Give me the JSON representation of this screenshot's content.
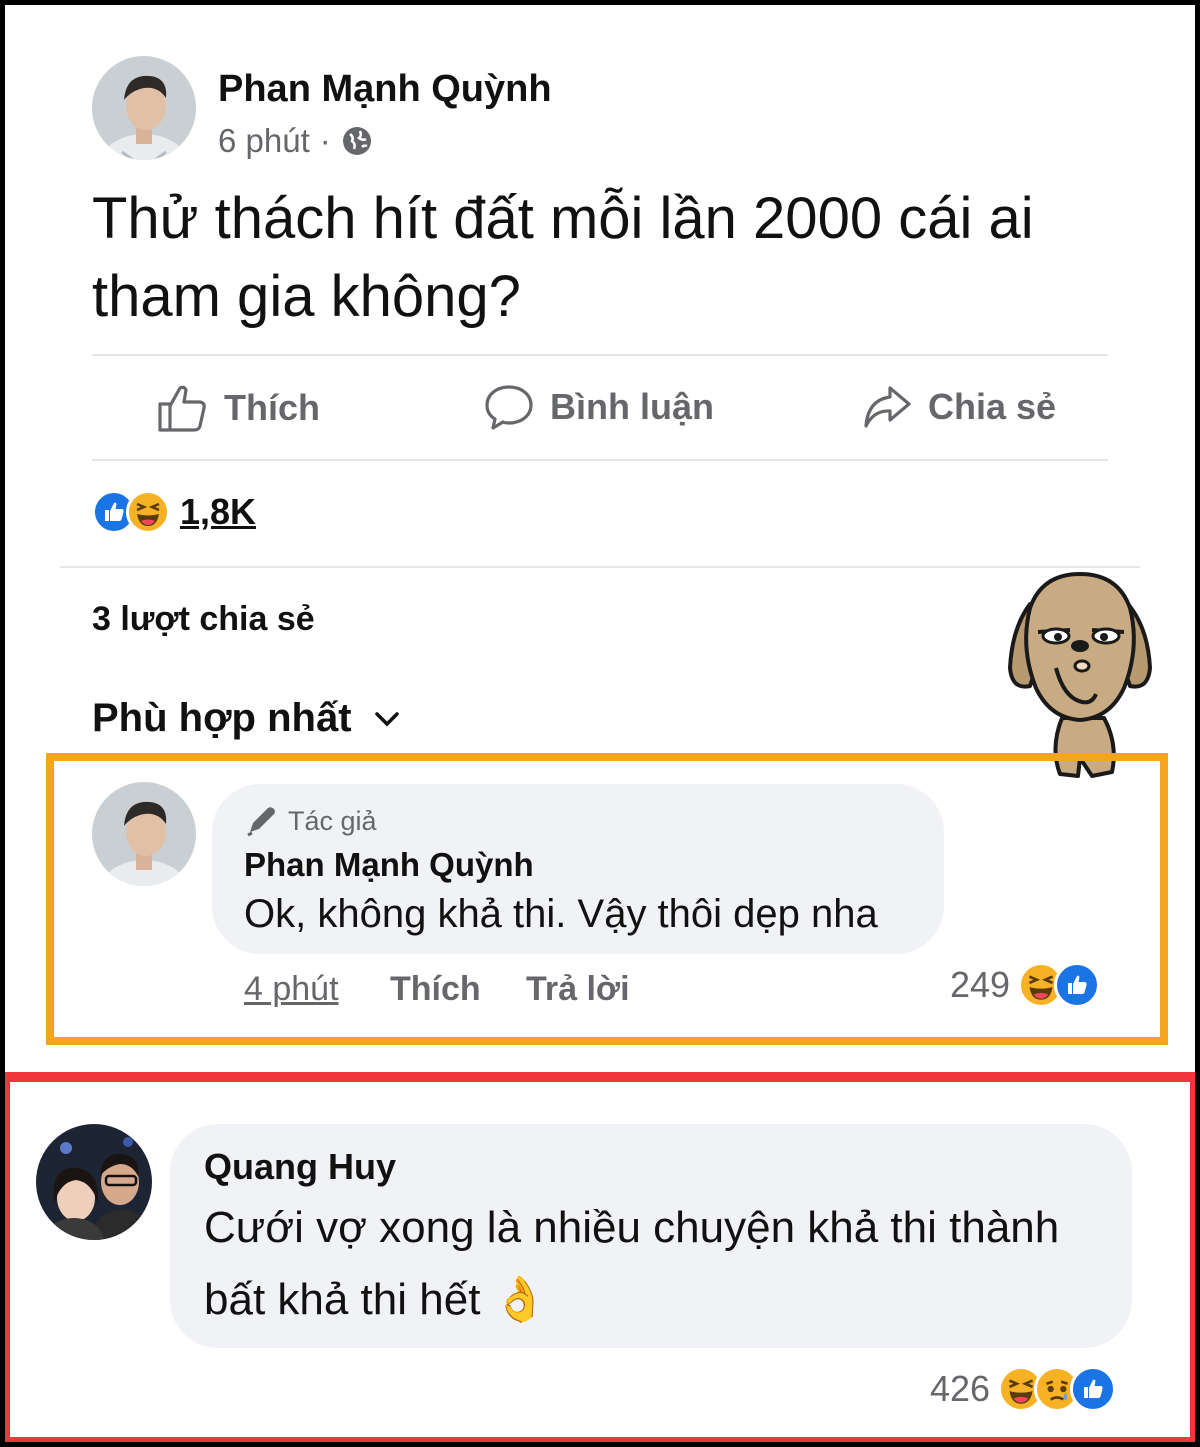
{
  "post": {
    "author": "Phan Mạnh Quỳnh",
    "time": "6 phút",
    "separator": "·",
    "text": "Thử thách hít đất mỗi lần 2000 cái ai tham gia không?",
    "actions": {
      "like": "Thích",
      "comment": "Bình luận",
      "share": "Chia sẻ"
    },
    "reaction_count": "1,8K",
    "shares": "3 lượt chia sẻ",
    "sort_label": "Phù hợp nhất"
  },
  "comments": [
    {
      "badge": "Tác giả",
      "author": "Phan Mạnh Quỳnh",
      "text": "Ok, không khả thi. Vậy thôi dẹp nha",
      "time": "4 phút",
      "like": "Thích",
      "reply": "Trả lời",
      "reaction_count": "249"
    },
    {
      "author": "Quang Huy",
      "text": "Cưới vợ xong là nhiều chuyện khả thi thành bất khả thi hết 👌",
      "reaction_count": "426"
    }
  ],
  "colors": {
    "highlight_orange": "#f4a51f",
    "highlight_red": "#f0363c",
    "like_blue": "#1b74e4",
    "meta_gray": "#65676b",
    "bubble_bg": "#f0f2f5"
  },
  "icons": [
    "globe-icon",
    "like-icon",
    "comment-icon",
    "share-icon",
    "chevron-down-icon",
    "pencil-icon",
    "haha-reaction-icon",
    "sad-reaction-icon",
    "like-reaction-icon",
    "dog-sticker"
  ]
}
